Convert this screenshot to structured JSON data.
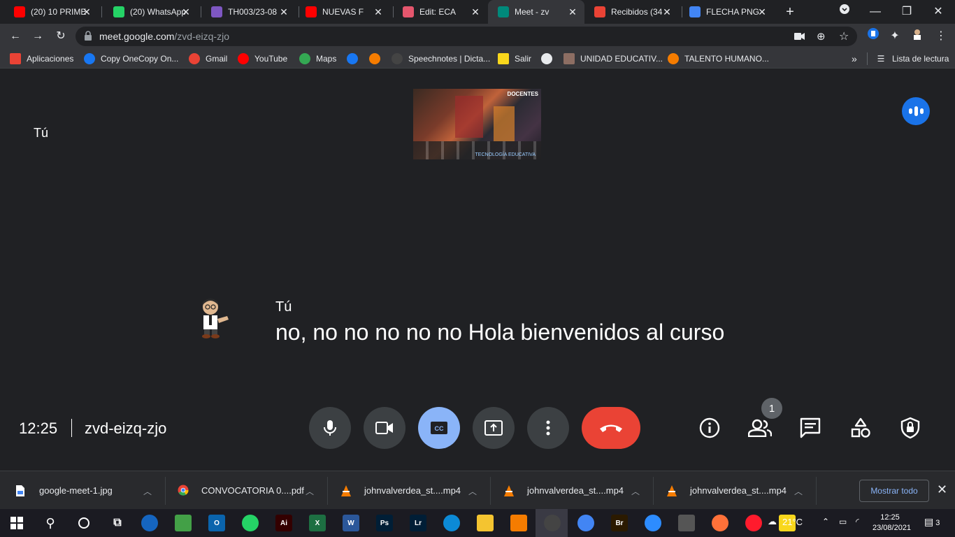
{
  "tabs": [
    {
      "title": "(20) 10 PRIME",
      "favicon": "youtube-icon",
      "color": "#ff0000"
    },
    {
      "title": "(20) WhatsApp",
      "favicon": "whatsapp-icon",
      "color": "#25d366"
    },
    {
      "title": "TH003/23-08",
      "favicon": "forms-icon",
      "color": "#7e57c2"
    },
    {
      "title": "NUEVAS F",
      "favicon": "youtube-icon",
      "color": "#ff0000"
    },
    {
      "title": "Edit: ECA",
      "favicon": "s-icon",
      "color": "#e5566d"
    },
    {
      "title": "Meet - zv",
      "favicon": "meet-icon",
      "color": "#00897b",
      "active": true
    },
    {
      "title": "Recibidos (34",
      "favicon": "gmail-icon",
      "color": "#ea4335"
    },
    {
      "title": "FLECHA PNG",
      "favicon": "google-icon",
      "color": "#4285f4"
    }
  ],
  "address": {
    "host": "meet.google.com",
    "path": "/zvd-eizq-zjo"
  },
  "bookmarks": [
    {
      "label": "Aplicaciones",
      "icon": "apps-grid-icon",
      "color": "#ea4335"
    },
    {
      "label": "Copy OneCopy On...",
      "icon": "facebook-icon",
      "color": "#1877f2"
    },
    {
      "label": "Gmail",
      "icon": "gmail-icon",
      "color": "#ea4335"
    },
    {
      "label": "YouTube",
      "icon": "youtube-icon",
      "color": "#ff0000"
    },
    {
      "label": "Maps",
      "icon": "maps-icon",
      "color": "#34a853"
    },
    {
      "label": "",
      "icon": "facebook-icon",
      "color": "#1877f2"
    },
    {
      "label": "",
      "icon": "blogger-icon",
      "color": "#f57c00"
    },
    {
      "label": "Speechnotes | Dicta...",
      "icon": "microphone-icon",
      "color": "#444444"
    },
    {
      "label": "Salir",
      "icon": "exit-icon",
      "color": "#f9d71c"
    },
    {
      "label": "",
      "icon": "globe-icon",
      "color": "#e8eaed"
    },
    {
      "label": "UNIDAD EDUCATIV...",
      "icon": "school-icon",
      "color": "#8d6e63"
    },
    {
      "label": "TALENTO HUMANO...",
      "icon": "blogger-icon",
      "color": "#f57c00"
    }
  ],
  "reading_list": "Lista de lectura",
  "meet": {
    "self_label": "Tú",
    "caption_speaker": "Tú",
    "caption_text": "no, no no no no no Hola bienvenidos al curso",
    "time": "12:25",
    "meeting_code": "zvd-eizq-zjo",
    "participant_count": "1"
  },
  "presentation": {
    "stamp": "DOCENTES",
    "caption": "TECNOLOGÍA EDUCATIVA"
  },
  "downloads": [
    {
      "name": "google-meet-1.jpg",
      "icon": "image-file-icon",
      "color": "#4285f4"
    },
    {
      "name": "CONVOCATORIA 0....pdf",
      "icon": "chrome-icon",
      "color": "#4285f4"
    },
    {
      "name": "johnvalverdea_st....mp4",
      "icon": "vlc-icon",
      "color": "#f57c00"
    },
    {
      "name": "johnvalverdea_st....mp4",
      "icon": "vlc-icon",
      "color": "#f57c00"
    },
    {
      "name": "johnvalverdea_st....mp4",
      "icon": "vlc-icon",
      "color": "#f57c00"
    }
  ],
  "show_all": "Mostrar todo",
  "taskbar": {
    "apps": [
      {
        "name": "firefox-dev-icon",
        "label": "",
        "color": "#1565c0"
      },
      {
        "name": "bluestacks-icon",
        "label": "",
        "color": "#43a047"
      },
      {
        "name": "outlook-icon",
        "label": "O",
        "color": "#0a64ad"
      },
      {
        "name": "whatsapp-icon",
        "label": "",
        "color": "#25d366"
      },
      {
        "name": "illustrator-icon",
        "label": "Ai",
        "color": "#330000"
      },
      {
        "name": "excel-icon",
        "label": "X",
        "color": "#1d6f42"
      },
      {
        "name": "word-icon",
        "label": "W",
        "color": "#2b579a"
      },
      {
        "name": "photoshop-icon",
        "label": "Ps",
        "color": "#001e36"
      },
      {
        "name": "lightroom-icon",
        "label": "Lr",
        "color": "#001e36"
      },
      {
        "name": "edge-icon",
        "label": "",
        "color": "#0c8ad6"
      },
      {
        "name": "explorer-icon",
        "label": "",
        "color": "#f4c430"
      },
      {
        "name": "vlc-icon",
        "label": "",
        "color": "#f57c00"
      },
      {
        "name": "obs-icon",
        "label": "",
        "color": "#444444"
      },
      {
        "name": "chrome-icon",
        "label": "",
        "color": "#4285f4"
      },
      {
        "name": "bridge-icon",
        "label": "Br",
        "color": "#2b1a00"
      },
      {
        "name": "zoom-icon",
        "label": "",
        "color": "#2d8cff"
      },
      {
        "name": "calculator-icon",
        "label": "",
        "color": "#555555"
      },
      {
        "name": "firefox-icon",
        "label": "",
        "color": "#ff7139"
      },
      {
        "name": "opera-icon",
        "label": "",
        "color": "#ff1b2d"
      },
      {
        "name": "sticky-notes-icon",
        "label": "",
        "color": "#f9d71c"
      }
    ],
    "temperature": "21°C",
    "time": "12:25",
    "date": "23/08/2021",
    "notifications": "3"
  }
}
